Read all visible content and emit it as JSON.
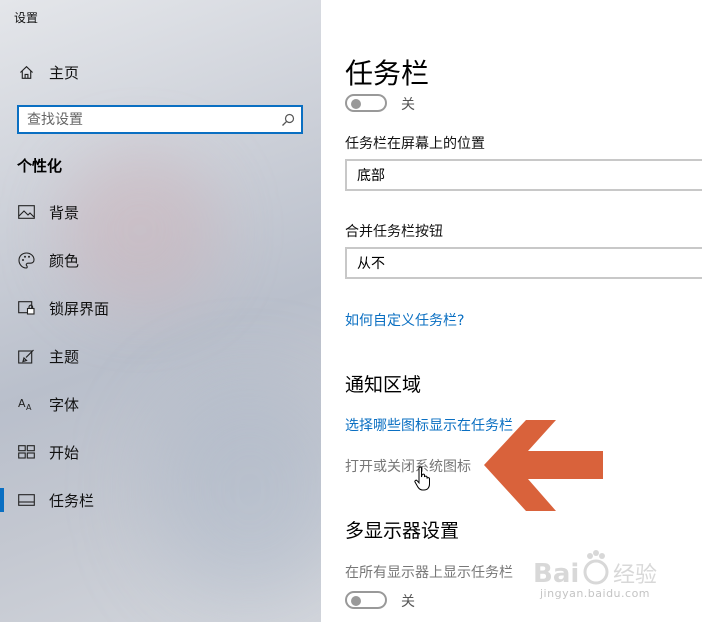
{
  "window": {
    "title": "设置"
  },
  "sidebar": {
    "home_label": "主页",
    "search_placeholder": "查找设置",
    "section_title": "个性化",
    "items": [
      {
        "label": "背景",
        "icon": "picture-icon"
      },
      {
        "label": "颜色",
        "icon": "palette-icon"
      },
      {
        "label": "锁屏界面",
        "icon": "lock-screen-icon"
      },
      {
        "label": "主题",
        "icon": "theme-brush-icon"
      },
      {
        "label": "字体",
        "icon": "font-icon"
      },
      {
        "label": "开始",
        "icon": "start-grid-icon"
      },
      {
        "label": "任务栏",
        "icon": "taskbar-icon",
        "active": true
      }
    ]
  },
  "main": {
    "title": "任务栏",
    "toggle_top_label": "关",
    "position_label": "任务栏在屏幕上的位置",
    "position_value": "底部",
    "combine_label": "合并任务栏按钮",
    "combine_value": "从不",
    "customize_link": "如何自定义任务栏?",
    "notification_heading": "通知区域",
    "select_icons_link": "选择哪些图标显示在任务栏",
    "system_icons_link": "打开或关闭系统图标",
    "multi_display_heading": "多显示器设置",
    "show_on_all_label": "在所有显示器上显示任务栏",
    "toggle_bottom_label": "关"
  },
  "colors": {
    "accent": "#0a6fc2",
    "arrow": "#d9623b"
  },
  "watermark": {
    "text": "jingyan.baidu.com"
  }
}
